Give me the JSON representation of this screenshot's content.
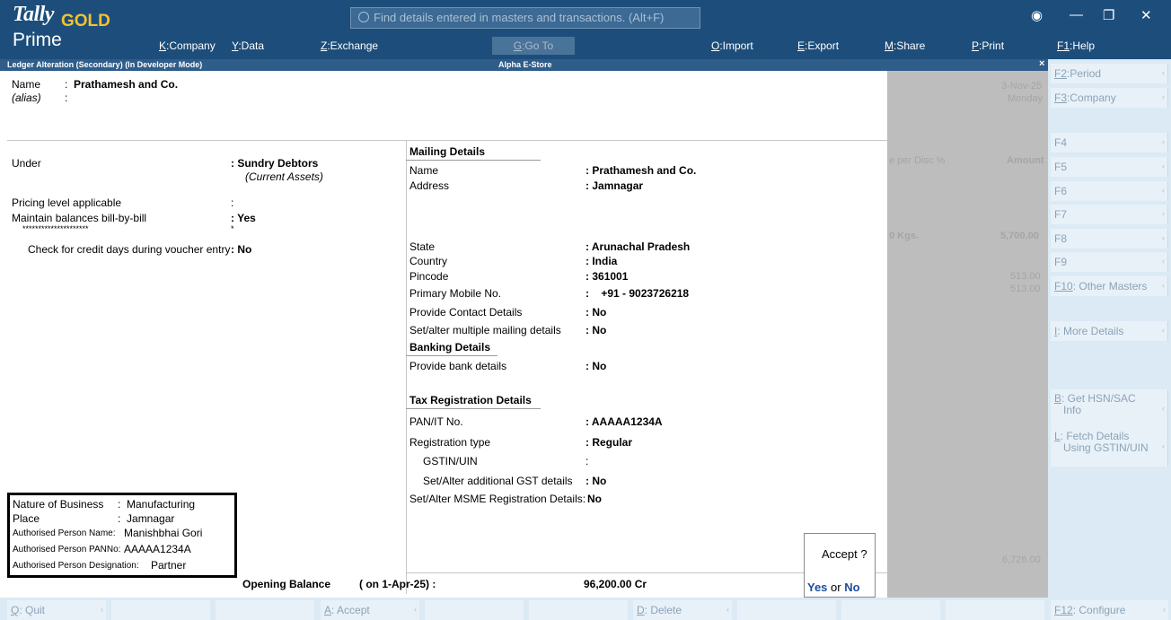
{
  "app": {
    "logo_tally": "Tally",
    "logo_gold": "GOLD",
    "logo_prime": "Prime",
    "search_placeholder": "Find details entered in masters and transactions. (Alt+F)"
  },
  "menu": [
    {
      "key": "K",
      "label": ":Company"
    },
    {
      "key": "Y",
      "label": ":Data"
    },
    {
      "key": "Z",
      "label": ":Exchange"
    },
    {
      "key": "G",
      "label": ":Go To"
    },
    {
      "key": "O",
      "label": ":Import"
    },
    {
      "key": "E",
      "label": ":Export"
    },
    {
      "key": "M",
      "label": ":Share"
    },
    {
      "key": "P",
      "label": ":Print"
    },
    {
      "key": "F1",
      "label": ":Help"
    }
  ],
  "titlebar": {
    "left": "Ledger Alteration (Secondary) (In Developer Mode)",
    "center": "Alpha E-Store",
    "close": "×"
  },
  "ledger": {
    "name_label": "Name",
    "name_value": "Prathamesh and Co.",
    "alias_label": "(alias)",
    "under_label": "Under",
    "under_value": "Sundry Debtors",
    "under_sub": "(Current Assets)",
    "pricing_label": "Pricing level applicable",
    "billbybill_label": "Maintain balances bill-by-bill",
    "billbybill_value": "Yes",
    "stars": "*********************",
    "star": "*",
    "credit_label": "Check for credit days during voucher entry",
    "credit_value": "No"
  },
  "mailing": {
    "heading": "Mailing Details",
    "name_label": "Name",
    "name_value": "Prathamesh and Co.",
    "address_label": "Address",
    "address_value": "Jamnagar",
    "state_label": "State",
    "state_value": "Arunachal Pradesh",
    "country_label": "Country",
    "country_value": "India",
    "pincode_label": "Pincode",
    "pincode_value": "361001",
    "mobile_label": "Primary Mobile No.",
    "mobile_value": "+91  -  9023726218",
    "contact_label": "Provide Contact Details",
    "contact_value": "No",
    "multi_label": "Set/alter multiple mailing details",
    "multi_value": "No"
  },
  "banking": {
    "heading": "Banking Details",
    "bank_label": "Provide bank details",
    "bank_value": "No"
  },
  "tax": {
    "heading": "Tax Registration Details",
    "pan_label": "PAN/IT No.",
    "pan_value": "AAAAA1234A",
    "regtype_label": "Registration type",
    "regtype_value": "Regular",
    "gstin_label": "GSTIN/UIN",
    "gst_add_label": "Set/Alter additional GST details",
    "gst_add_value": "No",
    "msme_label": "Set/Alter MSME Registration Details:",
    "msme_value": "No"
  },
  "business": {
    "nature_label": "Nature of Business",
    "nature_value": "Manufacturing",
    "place_label": "Place",
    "place_value": "Jamnagar",
    "auth_name_label": "Authorised Person Name:",
    "auth_name_value": "Manishbhai Gori",
    "auth_pan_label": "Authorised Person PANNo:",
    "auth_pan_value": "AAAAA1234A",
    "auth_desig_label": "Authorised Person Designation:",
    "auth_desig_value": "Partner"
  },
  "opening": {
    "label": "Opening Balance",
    "date": "( on 1-Apr-25) :",
    "value": "96,200.00 Cr"
  },
  "accept": {
    "question": "Accept ?",
    "yes": "Yes",
    "or": "or",
    "no": "No"
  },
  "background": {
    "date": "3-Nov-25",
    "day": "Monday",
    "col_headers": "e  per  Disc %",
    "amount_header": "Amount",
    "qty": "0 Kgs.",
    "amt1": "5,700.00",
    "amt2": "513.00",
    "amt3": "513.00",
    "total": "6,726.00"
  },
  "right_buttons": [
    {
      "key": "F2",
      "label": ":Period"
    },
    {
      "key": "F3",
      "label": ":Company"
    },
    {
      "key": "",
      "label": "F4"
    },
    {
      "key": "",
      "label": "F5"
    },
    {
      "key": "",
      "label": "F6"
    },
    {
      "key": "",
      "label": "F7"
    },
    {
      "key": "",
      "label": "F8"
    },
    {
      "key": "",
      "label": "F9"
    },
    {
      "key": "F10",
      "label": ": Other Masters"
    },
    {
      "key": "I",
      "label": ": More Details"
    },
    {
      "key": "B",
      "label": ": Get HSN/SAC",
      "label2": "Info"
    },
    {
      "key": "L",
      "label": ": Fetch Details",
      "label2": "Using GSTIN/UIN"
    }
  ],
  "bottom_buttons": [
    {
      "key": "Q",
      "label": ": Quit"
    },
    {
      "key": "A",
      "label": ": Accept"
    },
    {
      "key": "D",
      "label": ": Delete"
    },
    {
      "key": "F12",
      "label": ": Configure"
    }
  ],
  "colors": {
    "header_bg": "#1d4e7b",
    "title_bg": "#2f5d8a",
    "panel_bg": "#dbeaf5",
    "accent_link": "#1d4e9e"
  }
}
